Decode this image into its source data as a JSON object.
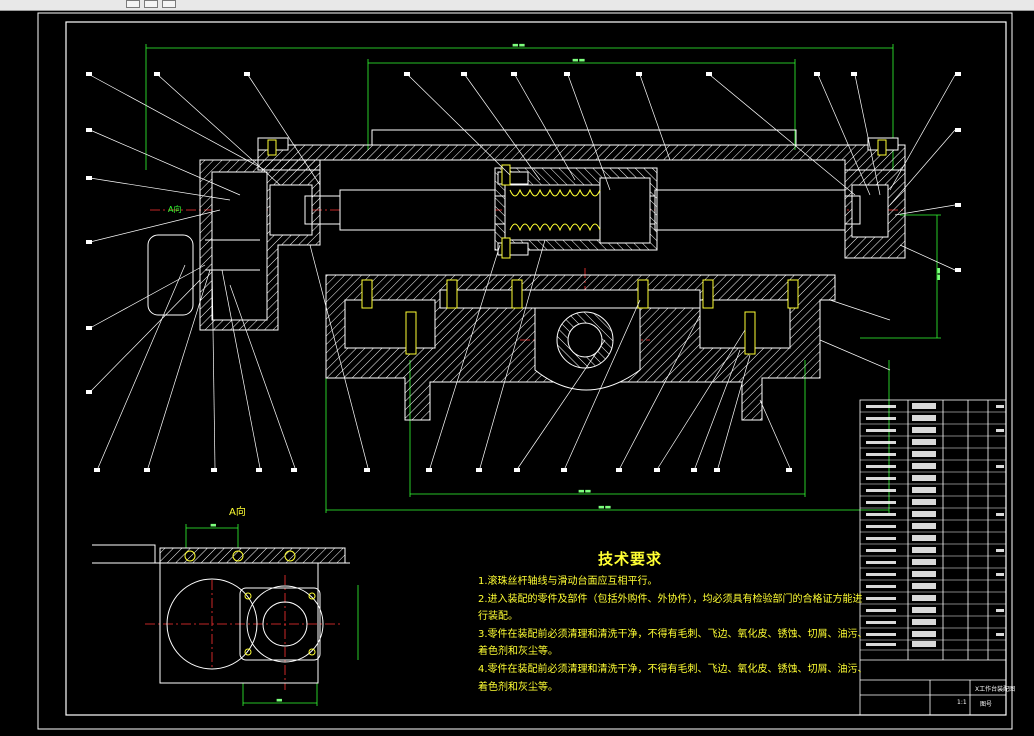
{
  "notes": {
    "title": "技术要求",
    "lines": [
      "1.滚珠丝杆轴线与滑动台面应互相平行。",
      "2.进入装配的零件及部件（包括外购件、外协件），均必须具有检验部门的合格证方能进",
      "行装配。",
      "3.零件在装配前必须清理和清洗干净，不得有毛刺、飞边、氧化皮、锈蚀、切屑、油污、",
      "着色剂和灰尘等。",
      "4.零件在装配前必须清理和清洗干净，不得有毛刺、飞边、氧化皮、锈蚀、切屑、油污、",
      "着色剂和灰尘等。"
    ]
  },
  "view_a_label": "A向",
  "side_view_label": "A向",
  "title_block": {
    "drawing_title": "X工作台装配图",
    "sheet_label": "图号",
    "scale": "1:1"
  },
  "colors": {
    "background": "#000000",
    "outline": "#ffffff",
    "dimension": "#33ff33",
    "centerline": "#ff3333",
    "part": "#ffff33",
    "notes": "#ffff33",
    "hatch": "#ffffff"
  },
  "window": {
    "buttons": [
      "minimize-button",
      "restore-button",
      "close-button"
    ]
  }
}
